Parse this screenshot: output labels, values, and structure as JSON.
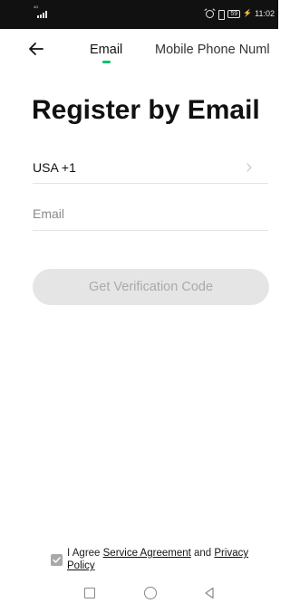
{
  "status_bar": {
    "network": "4G",
    "battery": "59",
    "time": "11:02"
  },
  "header": {
    "tabs": [
      {
        "label": "Email",
        "active": true
      },
      {
        "label": "Mobile Phone Numl",
        "active": false
      }
    ]
  },
  "main": {
    "title": "Register by Email",
    "country": "USA +1",
    "email_placeholder": "Email",
    "email_value": "",
    "verify_button": "Get Verification Code"
  },
  "agreement": {
    "checked": true,
    "prefix": "I Agree ",
    "service_link": "Service Agreement",
    "middle": " and ",
    "privacy_link": "Privacy Policy"
  },
  "colors": {
    "accent": "#00c26a",
    "button_disabled_bg": "#e5e5e5",
    "button_disabled_text": "#aaaaaa"
  },
  "icons": {
    "back": "arrow-left-icon",
    "chevron": "chevron-right-icon",
    "check": "checkmark-icon",
    "nav_recent": "square-icon",
    "nav_home": "circle-icon",
    "nav_back": "triangle-back-icon"
  }
}
